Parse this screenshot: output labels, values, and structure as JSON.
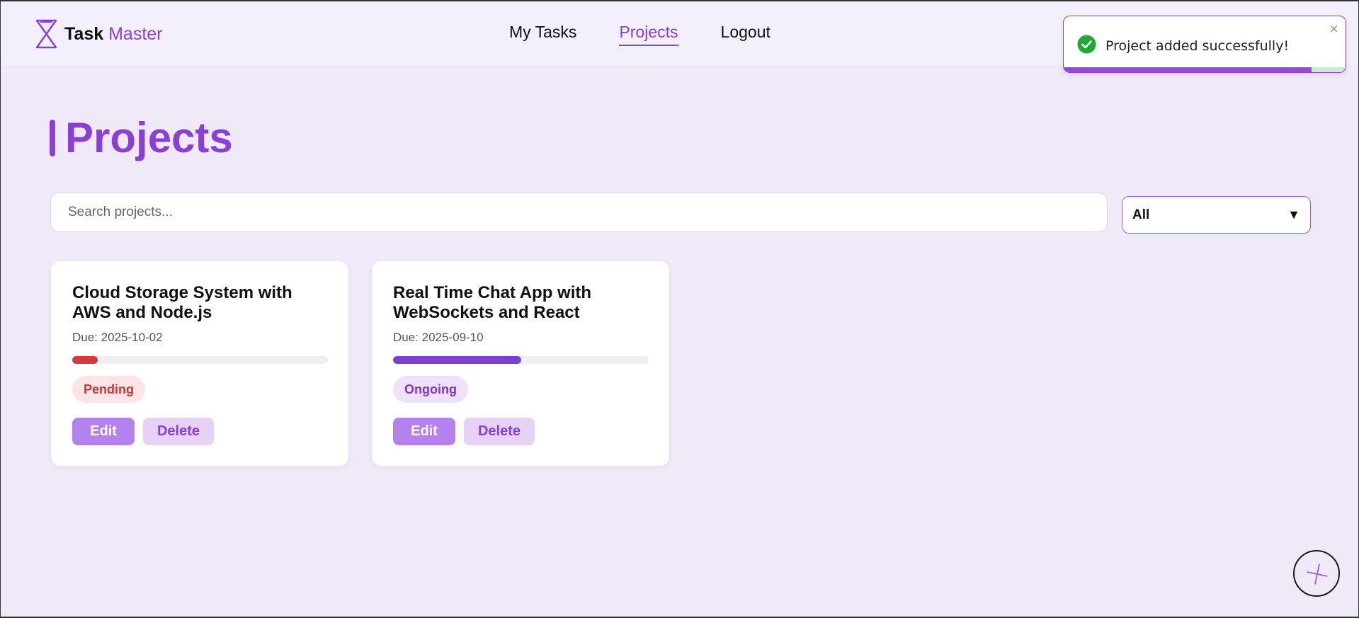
{
  "brand": {
    "name_bold": "Task",
    "name_accent": "Master",
    "icon": "hourglass-icon"
  },
  "nav": {
    "items": [
      {
        "label": "My Tasks",
        "active": false
      },
      {
        "label": "Projects",
        "active": true
      },
      {
        "label": "Logout",
        "active": false
      }
    ]
  },
  "toast": {
    "message": "Project added successfully!",
    "close_label": "×",
    "icon": "check-circle-icon",
    "progress": 0.88
  },
  "page": {
    "title": "Projects"
  },
  "search": {
    "placeholder": "Search projects...",
    "value": ""
  },
  "filter": {
    "selected": "All",
    "arrow": "▼"
  },
  "projects": [
    {
      "title": "Cloud Storage System with AWS and Node.js",
      "due": "Due: 2025-10-02",
      "progress": 0.1,
      "status": "Pending",
      "status_color": "#c9343a",
      "status_bg": "#fde4e6",
      "bar_color": "#d13b40",
      "edit_label": "Edit",
      "delete_label": "Delete"
    },
    {
      "title": "Real Time Chat App with WebSockets and React",
      "due": "Due: 2025-09-10",
      "progress": 0.5,
      "status": "Ongoing",
      "status_color": "#7a35c9",
      "status_bg": "#efe1fb",
      "bar_color": "#7c3fd6",
      "edit_label": "Edit",
      "delete_label": "Delete"
    }
  ],
  "fab": {
    "icon": "plus-icon"
  },
  "colors": {
    "accent": "#8a3fd9",
    "background": "#f0e9f7",
    "success": "#1fa93a"
  }
}
